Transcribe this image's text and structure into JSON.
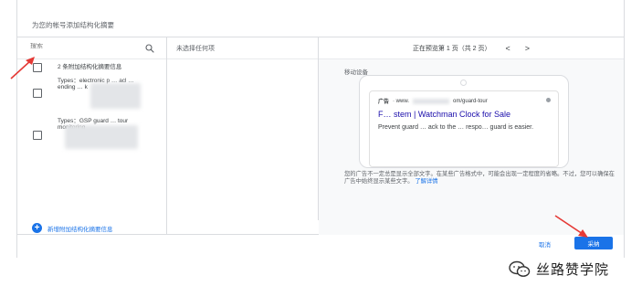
{
  "dialog": {
    "title": "为您的帐号添加结构化摘要"
  },
  "left": {
    "search_placeholder": "搜索",
    "options": [
      {
        "text": "2 条附加结构化摘要信息"
      },
      {
        "text": "Types：electronic p … acl … ending … k"
      },
      {
        "text": "Types：GSP guard … tour monitoring"
      }
    ],
    "add_link": "新增附加结构化摘要信息"
  },
  "middle": {
    "heading": "未选择任何项"
  },
  "right": {
    "pager_text": "正在预览第 1 页（共 2 页）",
    "prev_symbol": "<",
    "next_symbol": ">",
    "device_label": "移动设备",
    "ad": {
      "badge": "广告",
      "url_prefix": "· www.",
      "url_suffix": "om/guard-tour",
      "headline": "F… stem | Watchman Clock for Sale",
      "description": "Prevent guard … ack to the … respo… guard is easier."
    },
    "note": "您的广告不一定总是显示全部文字。在某些广告格式中，可能会出现一定程度的省略。不过，您可以确保在广告中始终显示某些文字。",
    "note_link": "了解详情"
  },
  "footer": {
    "cancel_label": "取消",
    "adopt_label": "采纳"
  },
  "watermark": {
    "text": "丝路赞学院"
  },
  "colors": {
    "accent": "#1a73e8",
    "arrow": "#e53935",
    "link": "#1a0dab"
  }
}
